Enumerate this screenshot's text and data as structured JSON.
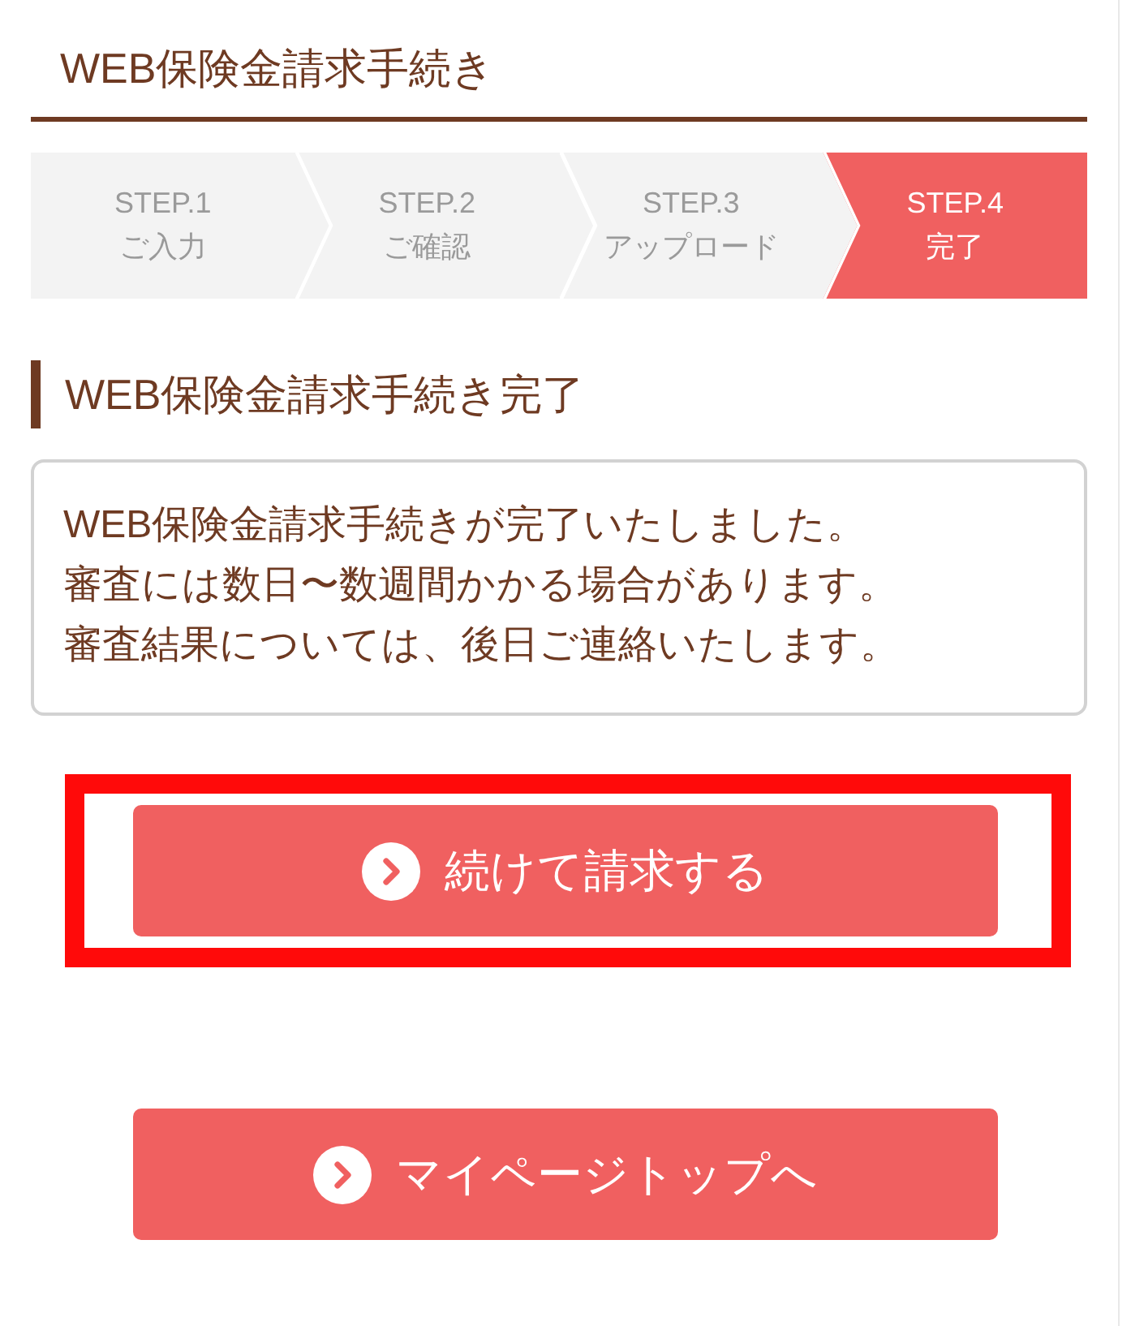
{
  "header": {
    "title": "WEB保険金請求手続き"
  },
  "steps": [
    {
      "number": "STEP.1",
      "label": "ご入力",
      "active": false
    },
    {
      "number": "STEP.2",
      "label": "ご確認",
      "active": false
    },
    {
      "number": "STEP.3",
      "label": "アップロード",
      "active": false
    },
    {
      "number": "STEP.4",
      "label": "完了",
      "active": true
    }
  ],
  "section": {
    "heading": "WEB保険金請求手続き完了",
    "message_lines": [
      "WEB保険金請求手続きが完了いたしました。",
      "審査には数日〜数週間かかる場合があります。",
      "審査結果については、後日ご連絡いたします。"
    ]
  },
  "buttons": [
    {
      "label": "続けて請求する",
      "highlighted": true
    },
    {
      "label": "マイページトップへ",
      "highlighted": false
    }
  ]
}
